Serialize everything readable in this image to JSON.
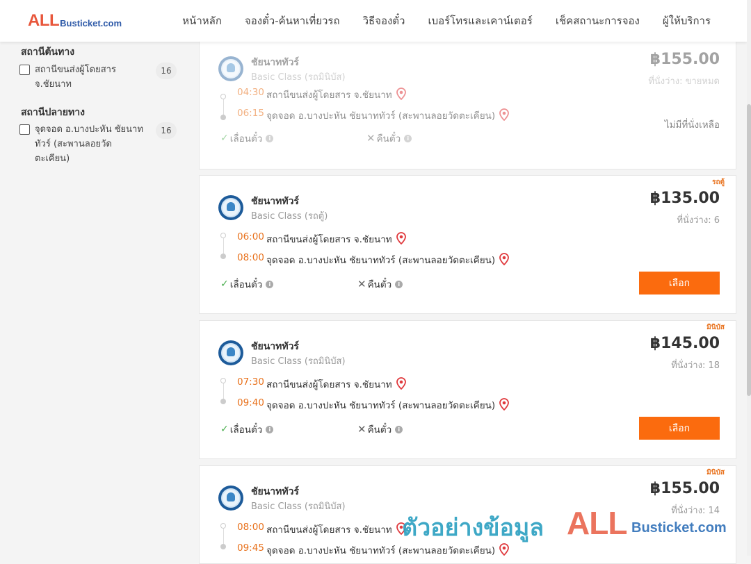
{
  "header": {
    "logo_all": "ALL",
    "logo_rest": "Busticket.com",
    "nav": [
      "หน้าหลัก",
      "จองตั๋ว-ค้นหาเที่ยวรถ",
      "วิธีจองตั๋ว",
      "เบอร์โทรและเคาน์เตอร์",
      "เช็คสถานะการจอง",
      "ผู้ให้บริการ"
    ]
  },
  "filters": {
    "origin_title": "สถานีต้นทาง",
    "origin_items": [
      {
        "label": "สถานีขนส่งผู้โดยสาร จ.ชัยนาท",
        "count": "16"
      }
    ],
    "dest_title": "สถานีปลายทาง",
    "dest_items": [
      {
        "label": "จุดจอด อ.บางปะหัน ชัยนาททัวร์ (สะพานลอยวัดตะเคียน)",
        "count": "16"
      }
    ]
  },
  "trips": [
    {
      "operator": "ชัยนาททัวร์",
      "class": "Basic Class (รถมินิบัส)",
      "badge": "",
      "price": "฿155.00",
      "seats": "ที่นั่งว่าง: ขายหมด",
      "depart_time": "04:30",
      "depart_place": "สถานีขนส่งผู้โดยสาร จ.ชัยนาท",
      "arrive_time": "06:15",
      "arrive_place": "จุดจอด อ.บางปะหัน ชัยนาททัวร์ (สะพานลอยวัดตะเคียน)",
      "reschedule": "เลื่อนตั๋ว",
      "refund": "คืนตั๋ว",
      "status": "ไม่มีที่นั่งเหลือ"
    },
    {
      "operator": "ชัยนาททัวร์",
      "class": "Basic Class (รถตู้)",
      "badge": "รถตู้",
      "price": "฿135.00",
      "seats": "ที่นั่งว่าง: 6",
      "depart_time": "06:00",
      "depart_place": "สถานีขนส่งผู้โดยสาร จ.ชัยนาท",
      "arrive_time": "08:00",
      "arrive_place": "จุดจอด อ.บางปะหัน ชัยนาททัวร์ (สะพานลอยวัดตะเคียน)",
      "reschedule": "เลื่อนตั๋ว",
      "refund": "คืนตั๋ว",
      "button": "เลือก"
    },
    {
      "operator": "ชัยนาททัวร์",
      "class": "Basic Class (รถมินิบัส)",
      "badge": "มินิบัส",
      "price": "฿145.00",
      "seats": "ที่นั่งว่าง: 18",
      "depart_time": "07:30",
      "depart_place": "สถานีขนส่งผู้โดยสาร จ.ชัยนาท",
      "arrive_time": "09:40",
      "arrive_place": "จุดจอด อ.บางปะหัน ชัยนาททัวร์ (สะพานลอยวัดตะเคียน)",
      "reschedule": "เลื่อนตั๋ว",
      "refund": "คืนตั๋ว",
      "button": "เลือก"
    },
    {
      "operator": "ชัยนาททัวร์",
      "class": "Basic Class (รถมินิบัส)",
      "badge": "มินิบัส",
      "price": "฿155.00",
      "seats": "ที่นั่งว่าง: 14",
      "depart_time": "08:00",
      "depart_place": "สถานีขนส่งผู้โดยสาร จ.ชัยนาท",
      "arrive_time": "09:45",
      "arrive_place": "จุดจอด อ.บางปะหัน ชัยนาททัวร์ (สะพานลอยวัดตะเคียน)"
    }
  ],
  "watermark": {
    "thai": "ตัวอย่างข้อมูล",
    "all": "ALL",
    "rest": "Busticket.com"
  },
  "colors": {
    "accent": "#fb6b0e",
    "time": "#e8711c",
    "pin": "#e03a3e",
    "check": "#4caf50"
  }
}
